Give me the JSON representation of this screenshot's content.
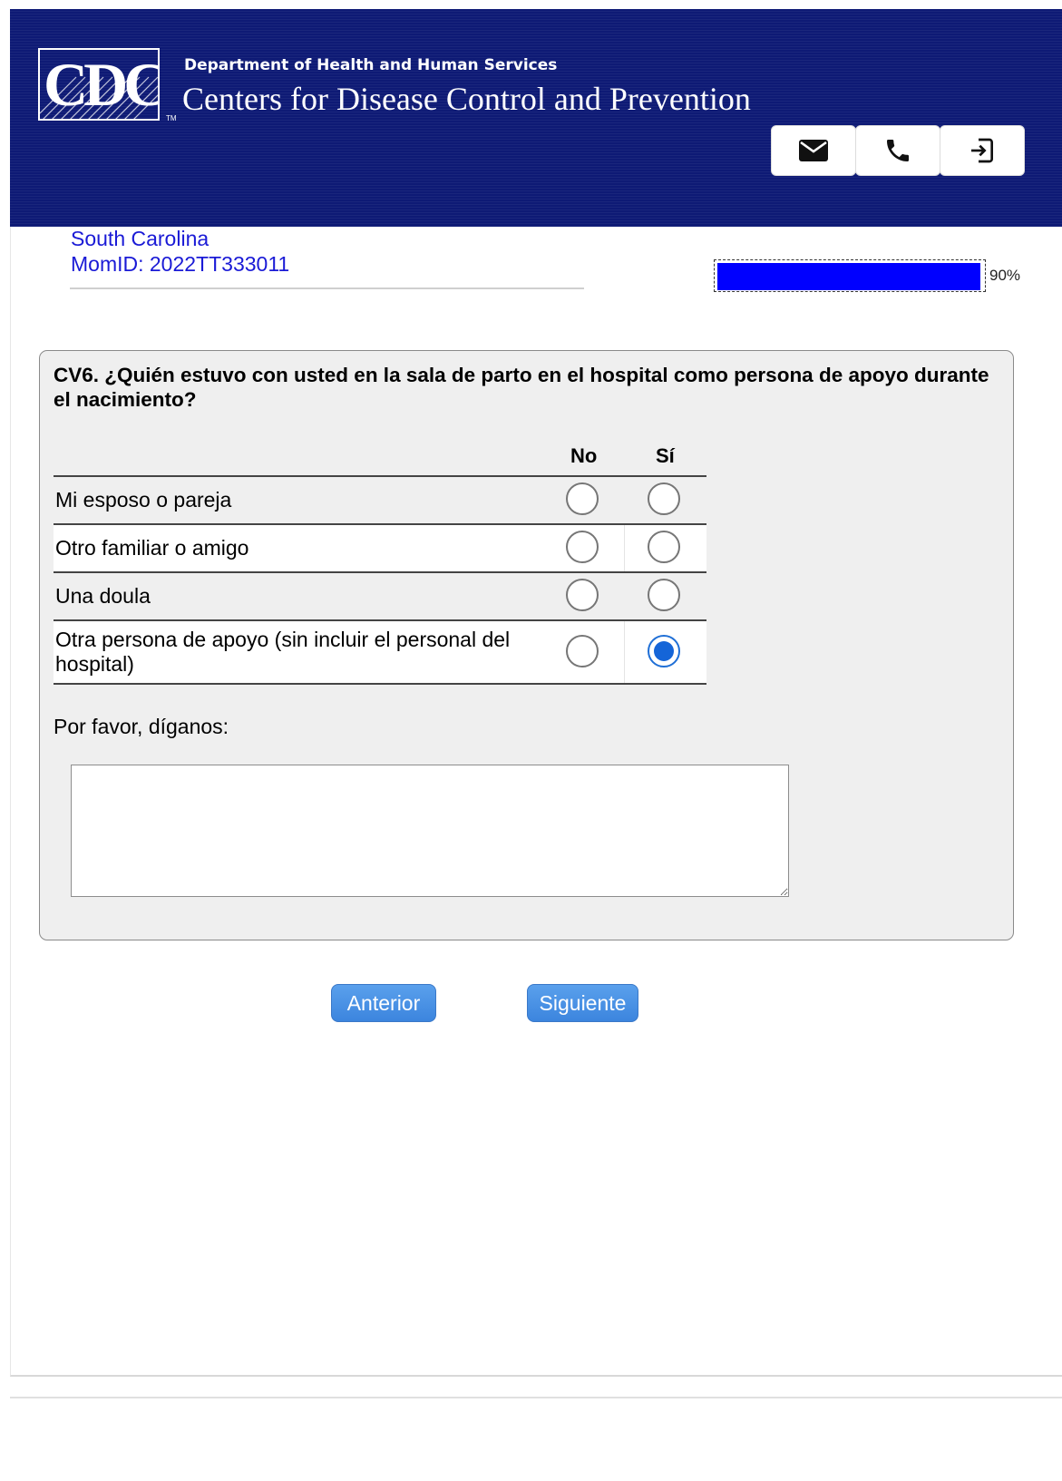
{
  "header": {
    "logo_text": "CDC",
    "department": "Department of Health and Human Services",
    "agency": "Centers for Disease Control and Prevention",
    "buttons": [
      {
        "icon": "mail-icon"
      },
      {
        "icon": "phone-icon"
      },
      {
        "icon": "exit-icon"
      }
    ],
    "colors": {
      "background": "#0e1a75"
    }
  },
  "respondent": {
    "state": "South Carolina",
    "mom_id": "MomID: 2022TT333011"
  },
  "progress": {
    "value_percent": 90,
    "label": "90%",
    "fill_color": "#0000ff"
  },
  "question": {
    "title": "CV6. ¿Quién estuvo con usted en la sala de parto en el hospital como persona de apoyo durante el nacimiento?",
    "columns": [
      "No",
      "Sí"
    ],
    "rows": [
      {
        "label": "Mi esposo o pareja",
        "answer": null
      },
      {
        "label": "Otro familiar o amigo",
        "answer": null
      },
      {
        "label": "Una doula",
        "answer": null
      },
      {
        "label": "Otra persona de apoyo (sin incluir el personal del hospital)",
        "answer": "Sí"
      }
    ],
    "followup_label": "Por favor, díganos:",
    "followup_value": ""
  },
  "navigation": {
    "previous": "Anterior",
    "next": "Siguiente",
    "button_color": "#4a92e4"
  }
}
